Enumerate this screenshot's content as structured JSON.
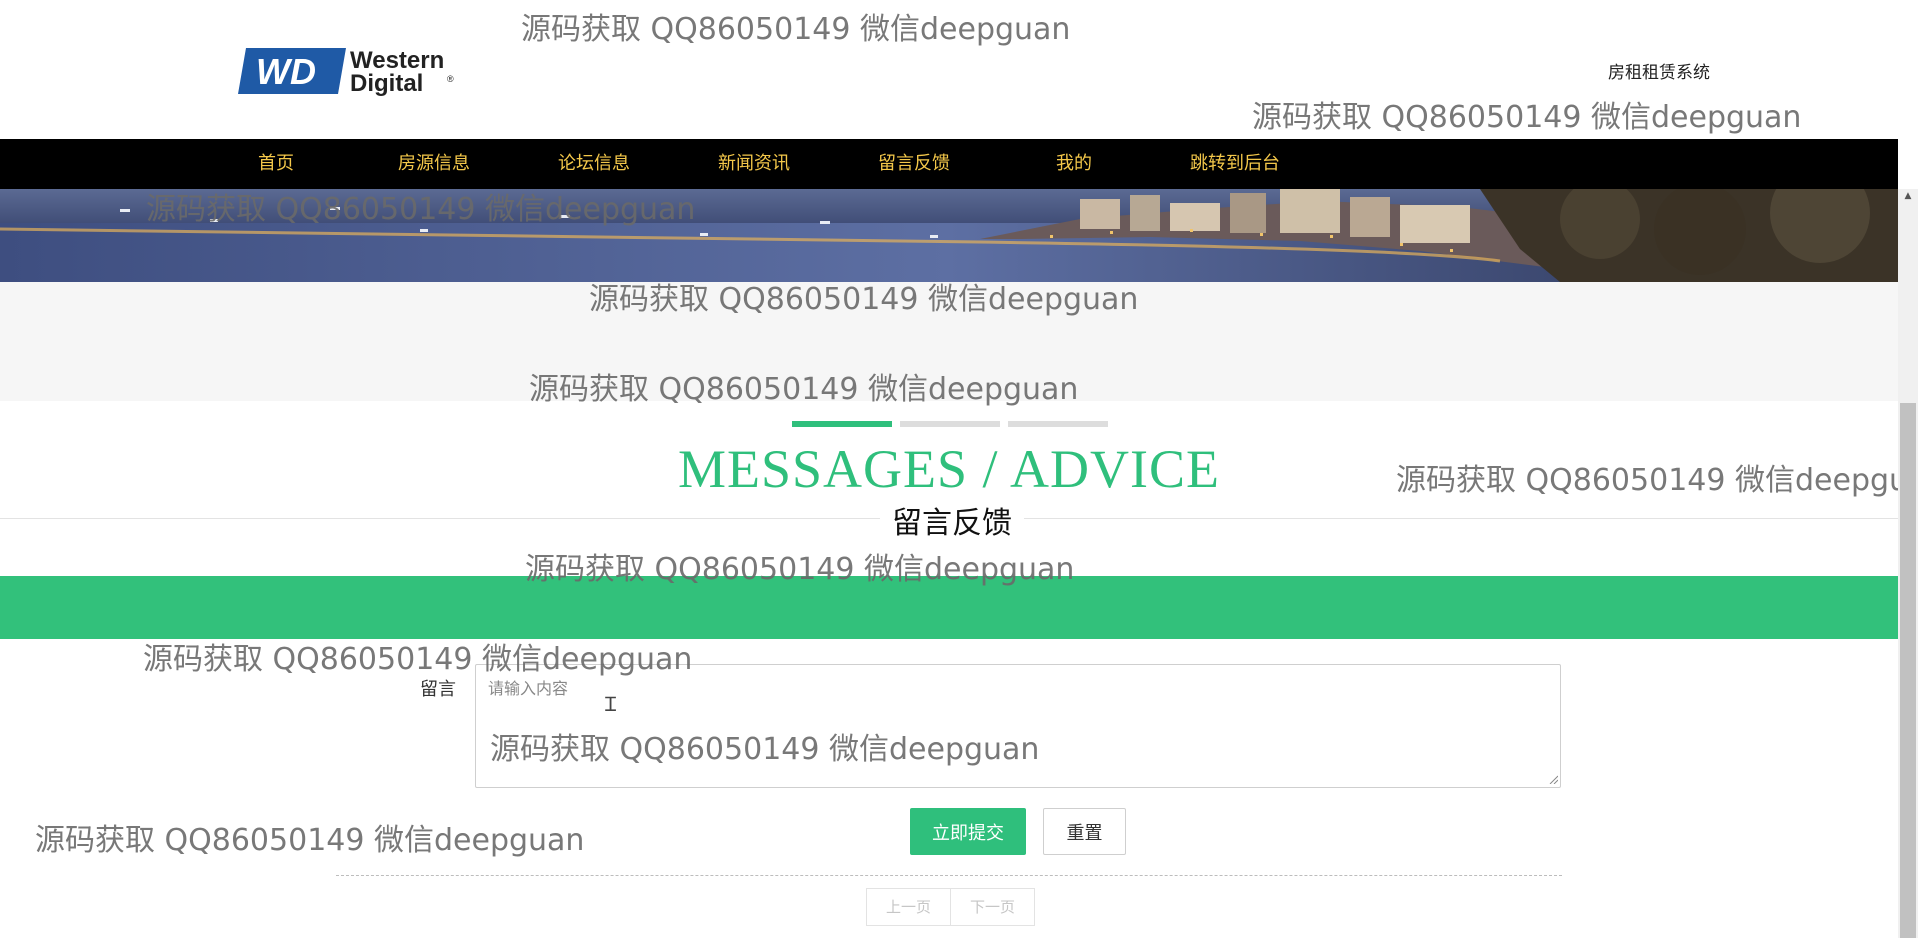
{
  "header": {
    "logo": {
      "mark": "WD",
      "line1": "Western",
      "line2": "Digital",
      "reg": "®"
    },
    "site_name": "房租租赁系统"
  },
  "nav": {
    "items": [
      "首页",
      "房源信息",
      "论坛信息",
      "新闻资讯",
      "留言反馈",
      "我的",
      "跳转到后台"
    ]
  },
  "section": {
    "title_en": "MESSAGES / ADVICE",
    "title_zh": "留言反馈"
  },
  "form": {
    "message_label": "留言",
    "message_placeholder": "请输入内容",
    "message_value": "",
    "submit_label": "立即提交",
    "reset_label": "重置"
  },
  "pagination": {
    "prev": "上一页",
    "next": "下一页"
  },
  "watermark": "源码获取 QQ86050149 微信deepguan",
  "colors": {
    "accent": "#2fbf7c",
    "nav_bg": "#000000",
    "nav_text": "#f4c84a",
    "logo_blue": "#1f5aa6"
  },
  "icons": {
    "text_cursor": "text-cursor-icon",
    "resize": "resize-grip-icon",
    "scroll_up": "scroll-up-arrow-icon"
  }
}
